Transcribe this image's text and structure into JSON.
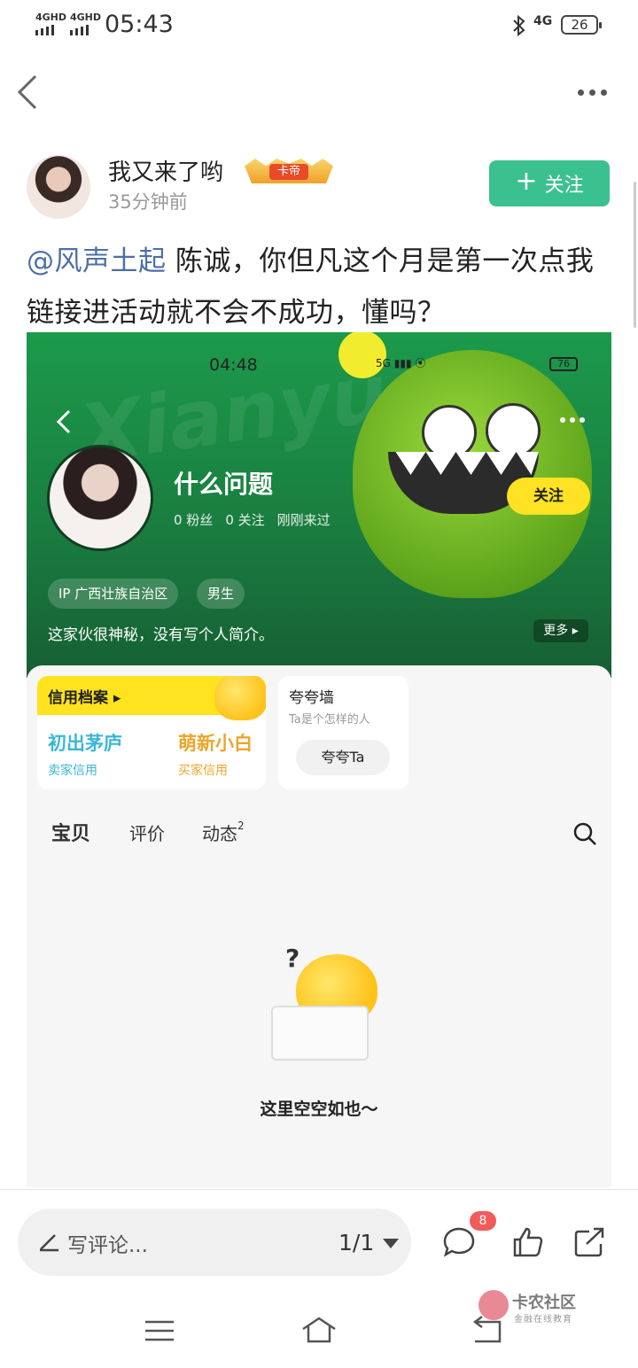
{
  "status_bar": {
    "network1": "4GHD",
    "network2": "4GHD",
    "time": "05:43",
    "network3": "4G",
    "battery": "26"
  },
  "post": {
    "author": "我又来了哟",
    "badge": "卡帝",
    "time_ago": "35分钟前",
    "follow_label": "关注",
    "mention": "@风声土起",
    "text": " 陈诚，你但凡这个月是第一次点我链接进活动就不会不成功，懂吗？"
  },
  "screenshot": {
    "time": "04:48",
    "signal_text": "5G",
    "battery": "76",
    "profile_name": "什么问题",
    "fans": "0 粉丝",
    "following": "0 关注",
    "last_seen": "刚刚来过",
    "follow_label": "关注",
    "tags": [
      "IP 广西壮族自治区",
      "男生"
    ],
    "bio": "这家伙很神秘，没有写个人简介。",
    "more_label": "更多",
    "credit_title": "信用档案",
    "seller_level": "初出茅庐",
    "seller_label": "卖家信用",
    "buyer_level": "萌新小白",
    "buyer_label": "买家信用",
    "praise_title": "夸夸墙",
    "praise_sub": "Ta是个怎样的人",
    "praise_button": "夸夸Ta",
    "tabs": [
      {
        "label": "宝贝"
      },
      {
        "label": "评价"
      },
      {
        "label": "动态",
        "count": "2"
      }
    ],
    "empty_text": "这里空空如也～"
  },
  "bottom": {
    "comment_placeholder": "写评论...",
    "page": "1/1",
    "comment_count": "8"
  },
  "watermark": {
    "title": "卡农社区",
    "subtitle": "金融在线教育"
  },
  "colors": {
    "accent": "#3bc18f",
    "mention": "#4d6fa8",
    "xianyu_yellow": "#ffe223"
  }
}
